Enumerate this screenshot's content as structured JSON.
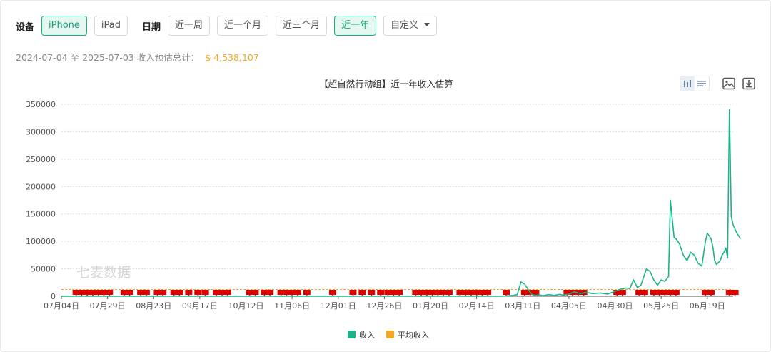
{
  "filters": {
    "device_label": "设备",
    "devices": [
      "iPhone",
      "iPad"
    ],
    "device_selected": "iPhone",
    "date_label": "日期",
    "dates": [
      "近一周",
      "近一个月",
      "近三个月",
      "近一年"
    ],
    "date_selected": "近一年",
    "custom_label": "自定义"
  },
  "summary": {
    "text": "2024-07-04 至 2025-07-03 收入预估总计：",
    "total": "$ 4,538,107"
  },
  "toolbar": {
    "icons": [
      "bar-chart-icon",
      "list-icon",
      "image-icon",
      "download-icon"
    ]
  },
  "colors": {
    "accent": "#15b084",
    "revenue_line": "#1db38a",
    "average_line": "#f5a623",
    "marker": "#e00000",
    "total_text": "#f5a623"
  },
  "chart_data": {
    "type": "line",
    "title": "【超自然行动组】近一年收入估算",
    "watermark": "七麦数据",
    "ylim": [
      0,
      350000
    ],
    "yticks": [
      "0",
      "50000",
      "100000",
      "150000",
      "200000",
      "250000",
      "300000",
      "350000"
    ],
    "x_start": "2024-07-04",
    "x_end": "2025-07-03",
    "xticks": [
      {
        "label": "07月04日",
        "date": "2024-07-04"
      },
      {
        "label": "07月29日",
        "date": "2024-07-29"
      },
      {
        "label": "08月23日",
        "date": "2024-08-23"
      },
      {
        "label": "09月17日",
        "date": "2024-09-17"
      },
      {
        "label": "10月12日",
        "date": "2024-10-12"
      },
      {
        "label": "11月06日",
        "date": "2024-11-06"
      },
      {
        "label": "12月01日",
        "date": "2024-12-01"
      },
      {
        "label": "12月26日",
        "date": "2024-12-26"
      },
      {
        "label": "01月20日",
        "date": "2025-01-20"
      },
      {
        "label": "02月14日",
        "date": "2025-02-14"
      },
      {
        "label": "03月11日",
        "date": "2025-03-11"
      },
      {
        "label": "04月05日",
        "date": "2025-04-05"
      },
      {
        "label": "04月30日",
        "date": "2025-04-30"
      },
      {
        "label": "05月25日",
        "date": "2025-05-25"
      },
      {
        "label": "06月19日",
        "date": "2025-06-19"
      }
    ],
    "legend_position": "bottom",
    "grid": true,
    "series": [
      {
        "name": "收入",
        "points": [
          [
            "2024-07-04",
            0
          ],
          [
            "2025-02-25",
            0
          ],
          [
            "2025-03-01",
            300
          ],
          [
            "2025-03-05",
            1200
          ],
          [
            "2025-03-08",
            3000
          ],
          [
            "2025-03-10",
            26000
          ],
          [
            "2025-03-12",
            22000
          ],
          [
            "2025-03-14",
            12000
          ],
          [
            "2025-03-16",
            3000
          ],
          [
            "2025-03-18",
            1500
          ],
          [
            "2025-03-20",
            2500
          ],
          [
            "2025-03-22",
            1000
          ],
          [
            "2025-03-25",
            3000
          ],
          [
            "2025-03-28",
            1500
          ],
          [
            "2025-03-31",
            3500
          ],
          [
            "2025-04-02",
            2000
          ],
          [
            "2025-04-05",
            4000
          ],
          [
            "2025-04-08",
            8000
          ],
          [
            "2025-04-11",
            5000
          ],
          [
            "2025-04-14",
            7000
          ],
          [
            "2025-04-18",
            5000
          ],
          [
            "2025-04-22",
            6000
          ],
          [
            "2025-04-26",
            4000
          ],
          [
            "2025-04-30",
            9000
          ],
          [
            "2025-05-03",
            13000
          ],
          [
            "2025-05-06",
            15000
          ],
          [
            "2025-05-08",
            14000
          ],
          [
            "2025-05-10",
            30000
          ],
          [
            "2025-05-12",
            16000
          ],
          [
            "2025-05-14",
            20000
          ],
          [
            "2025-05-17",
            50000
          ],
          [
            "2025-05-19",
            45000
          ],
          [
            "2025-05-21",
            30000
          ],
          [
            "2025-05-23",
            20000
          ],
          [
            "2025-05-25",
            30000
          ],
          [
            "2025-05-27",
            27000
          ],
          [
            "2025-05-29",
            36000
          ],
          [
            "2025-05-30",
            175000
          ],
          [
            "2025-06-01",
            107000
          ],
          [
            "2025-06-02",
            105000
          ],
          [
            "2025-06-04",
            95000
          ],
          [
            "2025-06-06",
            75000
          ],
          [
            "2025-06-08",
            65000
          ],
          [
            "2025-06-10",
            80000
          ],
          [
            "2025-06-12",
            75000
          ],
          [
            "2025-06-14",
            60000
          ],
          [
            "2025-06-16",
            55000
          ],
          [
            "2025-06-18",
            100000
          ],
          [
            "2025-06-19",
            115000
          ],
          [
            "2025-06-21",
            105000
          ],
          [
            "2025-06-22",
            90000
          ],
          [
            "2025-06-23",
            65000
          ],
          [
            "2025-06-24",
            58000
          ],
          [
            "2025-06-26",
            65000
          ],
          [
            "2025-06-27",
            75000
          ],
          [
            "2025-06-28",
            80000
          ],
          [
            "2025-06-29",
            88000
          ],
          [
            "2025-06-30",
            70000
          ],
          [
            "2025-07-01",
            340000
          ],
          [
            "2025-07-02",
            145000
          ],
          [
            "2025-07-03",
            130000
          ],
          [
            "2025-07-05",
            115000
          ],
          [
            "2025-07-07",
            105000
          ]
        ]
      },
      {
        "name": "平均收入",
        "value": 12400
      }
    ],
    "event_markers": [
      "2024-07-12",
      "2024-07-15",
      "2024-07-18",
      "2024-07-21",
      "2024-07-24",
      "2024-07-27",
      "2024-07-30",
      "2024-08-07",
      "2024-08-10",
      "2024-08-16",
      "2024-08-19",
      "2024-08-25",
      "2024-08-28",
      "2024-09-03",
      "2024-09-06",
      "2024-09-11",
      "2024-09-16",
      "2024-09-20",
      "2024-09-26",
      "2024-09-29",
      "2024-10-02",
      "2024-10-14",
      "2024-10-17",
      "2024-10-22",
      "2024-10-25",
      "2024-10-31",
      "2024-11-03",
      "2024-11-06",
      "2024-11-09",
      "2024-11-14",
      "2024-11-28",
      "2024-12-09",
      "2024-12-14",
      "2024-12-19",
      "2024-12-24",
      "2024-12-28",
      "2024-12-31",
      "2025-01-03",
      "2025-01-12",
      "2025-01-15",
      "2025-01-18",
      "2025-01-21",
      "2025-01-24",
      "2025-01-27",
      "2025-01-30",
      "2025-02-05",
      "2025-02-08",
      "2025-02-11",
      "2025-02-14",
      "2025-02-17",
      "2025-02-20",
      "2025-03-02",
      "2025-03-12",
      "2025-03-15",
      "2025-03-18",
      "2025-04-04",
      "2025-04-07",
      "2025-04-10",
      "2025-04-13",
      "2025-05-01",
      "2025-05-04",
      "2025-05-13",
      "2025-05-16",
      "2025-05-21",
      "2025-05-24",
      "2025-05-27",
      "2025-05-30",
      "2025-06-02",
      "2025-06-18",
      "2025-06-21",
      "2025-07-01",
      "2025-07-04"
    ]
  }
}
